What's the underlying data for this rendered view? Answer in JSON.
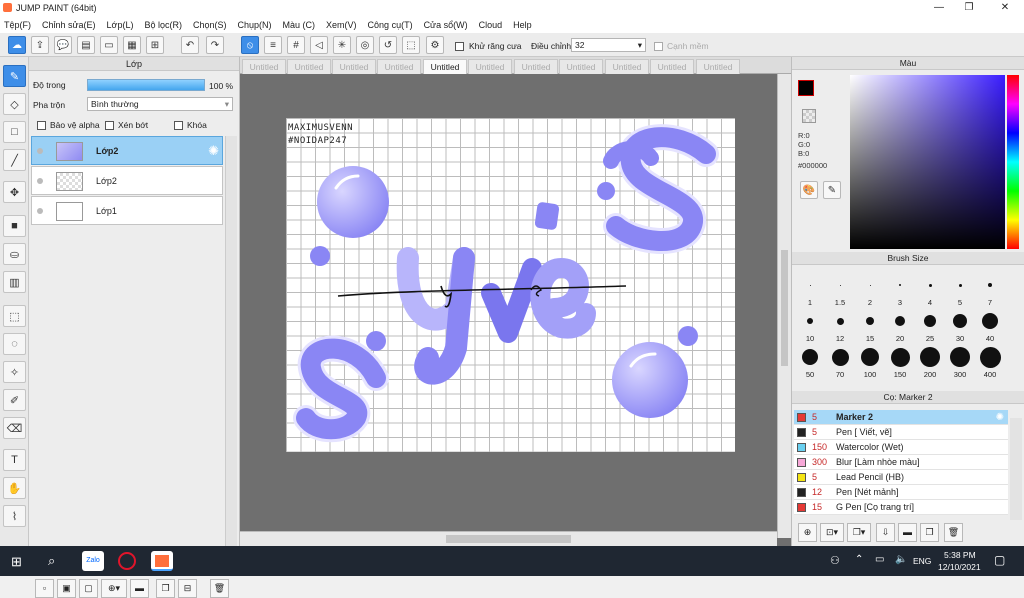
{
  "window": {
    "title": "JUMP PAINT (64bit)"
  },
  "menu": [
    "Tệp(F)",
    "Chỉnh sửa(E)",
    "Lớp(L)",
    "Bộ lọc(R)",
    "Chọn(S)",
    "Chụp(N)",
    "Màu (C)",
    "Xem(V)",
    "Công cụ(T)",
    "Cửa sổ(W)",
    "Cloud",
    "Help"
  ],
  "toolbar": {
    "antialias_label": "Khử răng cưa",
    "adjust_label": "Điều chỉnh",
    "adjust_value": "32",
    "smooth_label": "Cạnh mềm"
  },
  "layer_panel": {
    "title": "Lớp",
    "opacity_label": "Độ trong",
    "opacity_value": "100 %",
    "blend_label": "Pha trộn",
    "blend_value": "Bình thường",
    "protect_alpha": "Bảo vệ alpha",
    "clip": "Xén bớt",
    "lock": "Khóa",
    "layers": [
      {
        "name": "Lớp2",
        "selected": true
      },
      {
        "name": "Lớp2",
        "selected": false
      },
      {
        "name": "Lớp1",
        "selected": false
      }
    ]
  },
  "tabs": [
    "Untitled",
    "Untitled",
    "Untitled",
    "Untitled",
    "Untitled",
    "Untitled",
    "Untitled",
    "Untitled",
    "Untitled",
    "Untitled",
    "Untitled"
  ],
  "active_tab_index": 4,
  "artwork": {
    "watermark_line1": "MAXIMUSVENN",
    "watermark_line2": "#NOIDAP247"
  },
  "color_panel": {
    "title": "Màu",
    "r": "R:0",
    "g": "G:0",
    "b": "B:0",
    "hex": "#000000"
  },
  "brush_panel": {
    "title": "Brush Size",
    "sizes": [
      "1",
      "1.5",
      "2",
      "3",
      "4",
      "5",
      "7",
      "10",
      "12",
      "15",
      "20",
      "25",
      "30",
      "40",
      "50",
      "70",
      "100",
      "150",
      "200",
      "300",
      "400"
    ]
  },
  "tool_panel": {
    "title": "Cọ: Marker 2",
    "items": [
      {
        "size": "5",
        "name": "Marker 2",
        "color": "#e53935",
        "selected": true
      },
      {
        "size": "5",
        "name": "Pen [ Viết, vẽ]",
        "color": "#222222",
        "selected": false
      },
      {
        "size": "150",
        "name": "Watercolor (Wet)",
        "color": "#6ad0f0",
        "selected": false
      },
      {
        "size": "300",
        "name": "Blur [Làm nhòe màu]",
        "color": "#f7a8d8",
        "selected": false
      },
      {
        "size": "5",
        "name": "Lead Pencil (HB)",
        "color": "#f4e414",
        "selected": false
      },
      {
        "size": "12",
        "name": "Pen [Nét mảnh]",
        "color": "#222222",
        "selected": false
      },
      {
        "size": "15",
        "name": "G Pen [Cọ trang trí]",
        "color": "#e53935",
        "selected": false
      }
    ]
  },
  "taskbar": {
    "zalo": "Zalo",
    "lang": "ENG",
    "time": "5:38 PM",
    "date": "12/10/2021"
  },
  "colors": {
    "accent": "#3e8ee8",
    "art_purple": "#8a86f4"
  }
}
